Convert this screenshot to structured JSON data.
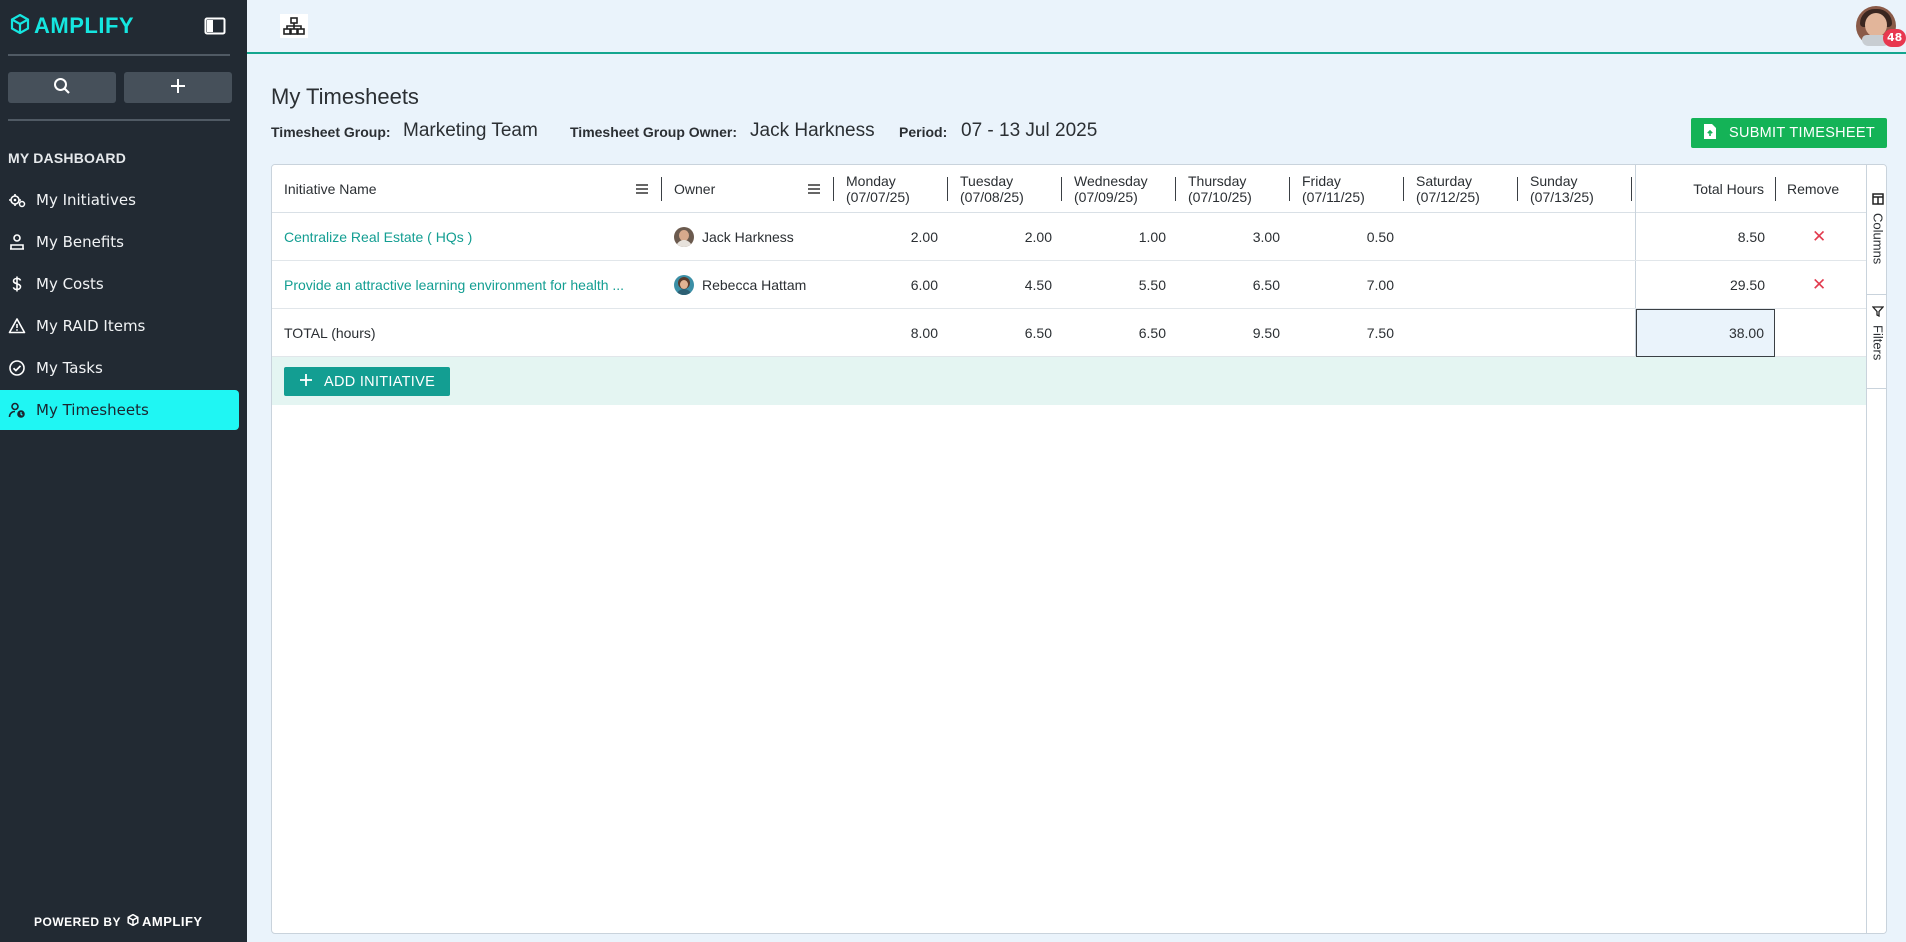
{
  "app": {
    "logo_text": "AMPLIFY",
    "powered_by": "POWERED BY",
    "powered_logo": "AMPLIFY"
  },
  "sidebar": {
    "section_label": "MY DASHBOARD",
    "items": [
      {
        "label": "My Initiatives",
        "icon": "initiatives-icon"
      },
      {
        "label": "My Benefits",
        "icon": "benefits-icon"
      },
      {
        "label": "My Costs",
        "icon": "dollar-icon"
      },
      {
        "label": "My RAID Items",
        "icon": "warning-icon"
      },
      {
        "label": "My Tasks",
        "icon": "check-circle-icon"
      },
      {
        "label": "My Timesheets",
        "icon": "user-clock-icon"
      }
    ],
    "active_index": 5
  },
  "topbar": {
    "notification_count": "48"
  },
  "page": {
    "title": "My Timesheets",
    "group_label": "Timesheet Group:",
    "group_value": "Marketing Team",
    "owner_label": "Timesheet Group Owner:",
    "owner_value": "Jack Harkness",
    "period_label": "Period:",
    "period_value": "07 - 13 Jul 2025",
    "submit_label": "SUBMIT TIMESHEET"
  },
  "grid": {
    "headers": {
      "initiative": "Initiative Name",
      "owner": "Owner",
      "days": [
        {
          "day": "Monday",
          "date": "(07/07/25)"
        },
        {
          "day": "Tuesday",
          "date": "(07/08/25)"
        },
        {
          "day": "Wednesday",
          "date": "(07/09/25)"
        },
        {
          "day": "Thursday",
          "date": "(07/10/25)"
        },
        {
          "day": "Friday",
          "date": "(07/11/25)"
        },
        {
          "day": "Saturday",
          "date": "(07/12/25)"
        },
        {
          "day": "Sunday",
          "date": "(07/13/25)"
        }
      ],
      "total": "Total Hours",
      "remove": "Remove"
    },
    "rows": [
      {
        "initiative": "Centralize Real Estate ( HQs )",
        "owner": "Jack Harkness",
        "hours": [
          "2.00",
          "2.00",
          "1.00",
          "3.00",
          "0.50",
          "",
          ""
        ],
        "total": "8.50",
        "remove": "✕"
      },
      {
        "initiative": "Provide an attractive learning environment for health ...",
        "owner": "Rebecca Hattam",
        "hours": [
          "6.00",
          "4.50",
          "5.50",
          "6.50",
          "7.00",
          "",
          ""
        ],
        "total": "29.50",
        "remove": "✕"
      }
    ],
    "total_row": {
      "label": "TOTAL (hours)",
      "hours": [
        "8.00",
        "6.50",
        "6.50",
        "9.50",
        "7.50",
        "",
        ""
      ],
      "total": "38.00"
    },
    "add_label": "ADD INITIATIVE",
    "side_tabs": {
      "columns": "Columns",
      "filters": "Filters"
    }
  },
  "colors": {
    "accent": "#139e92",
    "active_nav": "#1ff6f3",
    "submit": "#14b357",
    "remove": "#e23b4f"
  }
}
